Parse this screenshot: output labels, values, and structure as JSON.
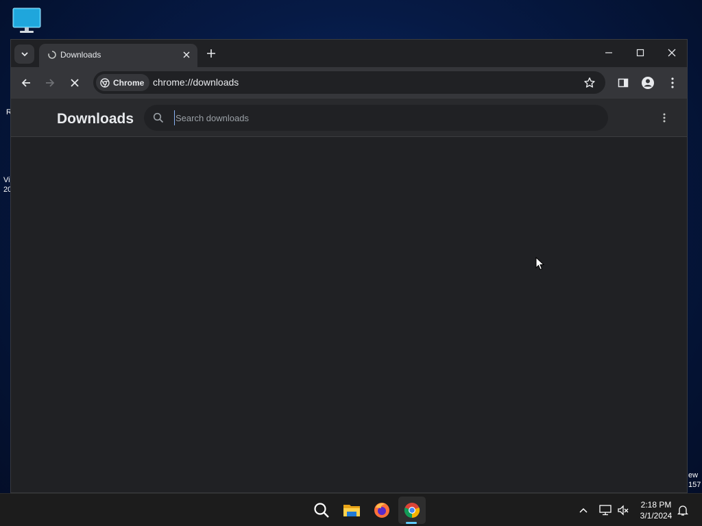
{
  "desktop": {
    "edge_texts": [
      "R",
      "Vi",
      "20"
    ],
    "edge_texts_right": [
      "ew",
      "157"
    ]
  },
  "browser": {
    "tab": {
      "title": "Downloads"
    },
    "omnibox": {
      "chip_label": "Chrome",
      "url": "chrome://downloads"
    }
  },
  "downloads": {
    "title": "Downloads",
    "search_placeholder": "Search downloads"
  },
  "taskbar": {
    "apps": [
      "search-icon",
      "file-explorer-icon",
      "firefox-icon",
      "chrome-icon"
    ],
    "time": "2:18 PM",
    "date": "3/1/2024"
  },
  "colors": {
    "accent": "#60cdff",
    "page_bg": "#202124",
    "toolbar_bg": "#35363a"
  }
}
